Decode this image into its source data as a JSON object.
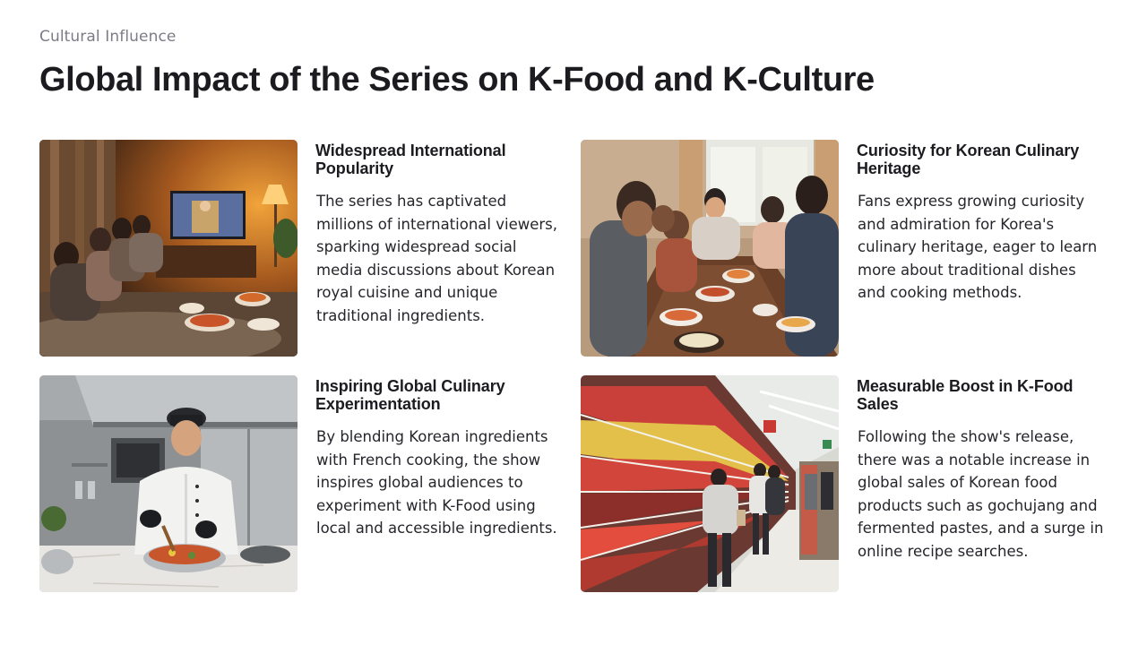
{
  "header": {
    "eyebrow": "Cultural Influence",
    "title": "Global Impact of the Series on K-Food and K-Culture"
  },
  "cards": [
    {
      "heading": "Widespread International Popularity",
      "body": "The series has captivated millions of international viewers, sparking widespread social media discussions about Korean royal cuisine and unique traditional ingredients."
    },
    {
      "heading": "Curiosity for Korean Culinary Heritage",
      "body": "Fans express growing curiosity and admiration for Korea's culinary heritage, eager to learn more about traditional dishes and cooking methods."
    },
    {
      "heading": "Inspiring Global Culinary Experimentation",
      "body": "By blending Korean ingredients with French cooking, the show inspires global audiences to experiment with K-Food using local and accessible ingredients."
    },
    {
      "heading": "Measurable Boost in K-Food Sales",
      "body": "Following the show's release, there was a notable increase in global sales of Korean food products such as gochujang and fermented pastes, and a surge in online recipe searches."
    }
  ]
}
